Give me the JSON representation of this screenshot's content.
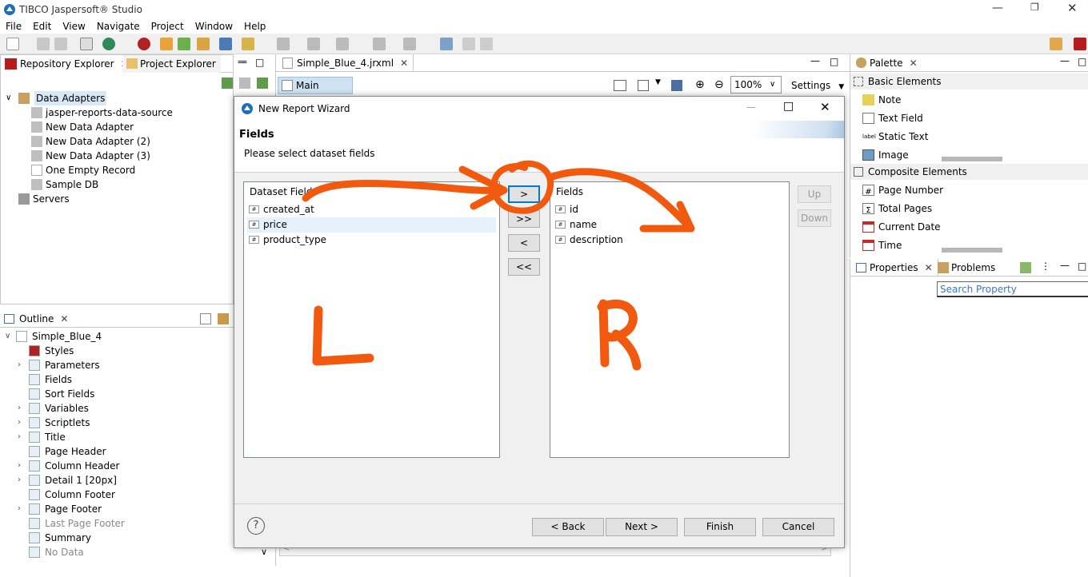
{
  "window": {
    "title": "TIBCO Jaspersoft® Studio"
  },
  "menu": [
    "File",
    "Edit",
    "View",
    "Navigate",
    "Project",
    "Window",
    "Help"
  ],
  "left_panel": {
    "tabs": [
      {
        "label": "Repository Explorer"
      },
      {
        "label": "Project Explorer"
      }
    ],
    "tree": [
      {
        "label": "Data Adapters"
      },
      {
        "label": "jasper-reports-data-source"
      },
      {
        "label": "New Data Adapter"
      },
      {
        "label": "New Data Adapter (2)"
      },
      {
        "label": "New Data Adapter (3)"
      },
      {
        "label": "One Empty Record"
      },
      {
        "label": "Sample DB"
      },
      {
        "label": "Servers"
      }
    ]
  },
  "outline": {
    "tab": "Outline",
    "items": [
      "Simple_Blue_4",
      "Styles",
      "Parameters",
      "Fields",
      "Sort Fields",
      "Variables",
      "Scriptlets",
      "Title",
      "Page Header",
      "Column Header",
      "Detail 1 [20px]",
      "Column Footer",
      "Page Footer",
      "Last Page Footer",
      "Summary",
      "No Data"
    ]
  },
  "editor": {
    "tab": "Simple_Blue_4.jrxml",
    "main_report": "Main Report",
    "zoom": "100%",
    "settings": "Settings"
  },
  "palette": {
    "tab": "Palette",
    "basic_header": "Basic Elements",
    "basic": [
      "Note",
      "Text Field",
      "Static Text",
      "Image"
    ],
    "composite_header": "Composite Elements",
    "composite": [
      "Page Number",
      "Total Pages",
      "Current Date",
      "Time"
    ]
  },
  "properties": {
    "tabs": [
      "Properties",
      "Problems"
    ],
    "search_placeholder": "Search Property"
  },
  "dialog": {
    "title": "New Report Wizard",
    "heading": "Fields",
    "subheading": "Please select dataset fields",
    "left_list": {
      "header": "Dataset Fields",
      "items": [
        "created_at",
        "price",
        "product_type"
      ]
    },
    "right_list": {
      "header": "Fields",
      "items": [
        "id",
        "name",
        "description"
      ]
    },
    "move_buttons": [
      ">",
      ">>",
      "<",
      "<<"
    ],
    "up": "Up",
    "down": "Down",
    "help": "?",
    "back": "< Back",
    "next": "Next >",
    "finish": "Finish",
    "cancel": "Cancel"
  },
  "annotations": {
    "left_letter": "L",
    "right_letter": "R",
    "color": "#f15a0e"
  }
}
